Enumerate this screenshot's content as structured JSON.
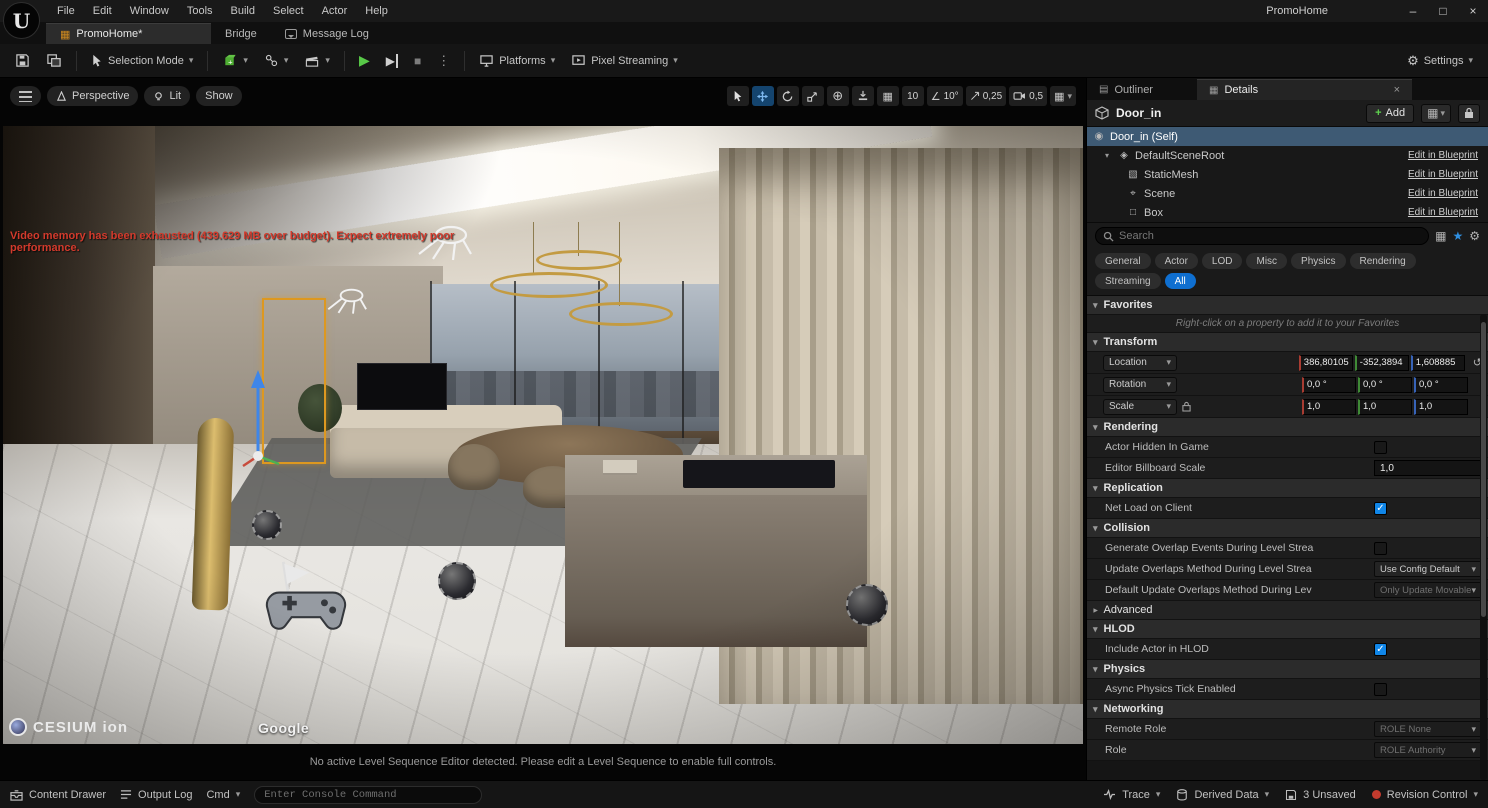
{
  "window": {
    "title": "PromoHome"
  },
  "menubar": {
    "items": [
      "File",
      "Edit",
      "Window",
      "Tools",
      "Build",
      "Select",
      "Actor",
      "Help"
    ]
  },
  "tabs": {
    "promohome": "PromoHome*",
    "bridge": "Bridge",
    "message_log": "Message Log"
  },
  "toolbar": {
    "selection_mode": "Selection Mode",
    "platforms": "Platforms",
    "pixel_streaming": "Pixel Streaming",
    "settings": "Settings"
  },
  "viewport": {
    "perspective": "Perspective",
    "lit": "Lit",
    "show": "Show",
    "snap_grid": "10",
    "snap_angle": "10°",
    "snap_scale": "0,25",
    "camera_speed": "0,5",
    "warning": "Video memory has been exhausted (439.629 MB over budget). Expect extremely poor performance.",
    "cesium": "CESIUM ion",
    "google": "Google",
    "sequence_message": "No active Level Sequence Editor detected. Please edit a Level Sequence to enable full controls."
  },
  "details": {
    "tab_outliner": "Outliner",
    "tab_details": "Details",
    "actor_name": "Door_in",
    "add_label": "Add",
    "tree": [
      {
        "label": "Door_in (Self)",
        "link": ""
      },
      {
        "label": "DefaultSceneRoot",
        "link": "Edit in Blueprint"
      },
      {
        "label": "StaticMesh",
        "link": "Edit in Blueprint"
      },
      {
        "label": "Scene",
        "link": "Edit in Blueprint"
      },
      {
        "label": "Box",
        "link": "Edit in Blueprint"
      }
    ],
    "search_placeholder": "Search",
    "filters": [
      "General",
      "Actor",
      "LOD",
      "Misc",
      "Physics",
      "Rendering",
      "Streaming",
      "All"
    ],
    "favorites": {
      "title": "Favorites",
      "hint": "Right-click on a property to add it to your Favorites"
    },
    "transform": {
      "title": "Transform",
      "location_label": "Location",
      "rotation_label": "Rotation",
      "scale_label": "Scale",
      "location": {
        "x": "386,80105",
        "y": "-352,3894",
        "z": "1,608885"
      },
      "rotation": {
        "x": "0,0 °",
        "y": "0,0 °",
        "z": "0,0 °"
      },
      "scale": {
        "x": "1,0",
        "y": "1,0",
        "z": "1,0"
      }
    },
    "rendering": {
      "title": "Rendering",
      "actor_hidden_label": "Actor Hidden In Game",
      "actor_hidden_checked": false,
      "billboard_label": "Editor Billboard Scale",
      "billboard_value": "1,0"
    },
    "replication": {
      "title": "Replication",
      "net_load_label": "Net Load on Client",
      "net_load_checked": true
    },
    "collision": {
      "title": "Collision",
      "generate_overlap_label": "Generate Overlap Events During Level Strea",
      "generate_overlap_checked": false,
      "update_overlaps_label": "Update Overlaps Method During Level Strea",
      "update_overlaps_value": "Use Config Default",
      "default_update_label": "Default Update Overlaps Method During Lev",
      "default_update_value": "Only Update Movable"
    },
    "advanced_title": "Advanced",
    "hlod": {
      "title": "HLOD",
      "include_label": "Include Actor in HLOD",
      "include_checked": true
    },
    "physics": {
      "title": "Physics",
      "async_label": "Async Physics Tick Enabled",
      "async_checked": false
    },
    "networking": {
      "title": "Networking",
      "remote_role_label": "Remote Role",
      "remote_role_value": "ROLE None",
      "role_label": "Role",
      "role_value": "ROLE Authority"
    }
  },
  "statusbar": {
    "content_drawer": "Content Drawer",
    "output_log": "Output Log",
    "cmd": "Cmd",
    "console_placeholder": "Enter Console Command",
    "trace": "Trace",
    "derived_data": "Derived Data",
    "unsaved": "3 Unsaved",
    "revision_control": "Revision Control"
  }
}
